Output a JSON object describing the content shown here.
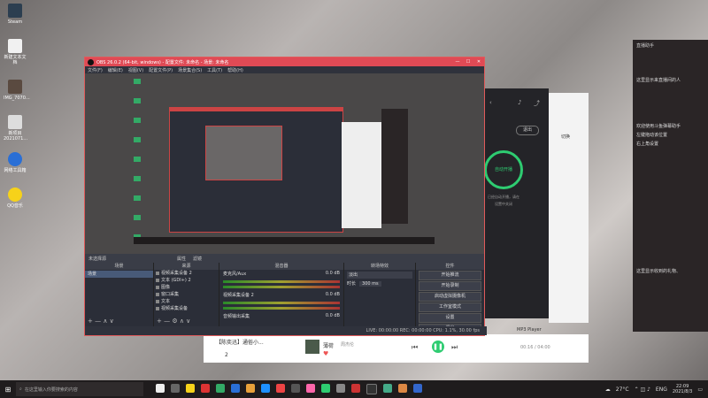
{
  "desktop": {
    "icons": [
      {
        "label": "Steam"
      },
      {
        "label": "新建文本文档"
      },
      {
        "label": "IMG_7070..."
      },
      {
        "label": "新项目\n2021071..."
      },
      {
        "label": "网络工具箱"
      },
      {
        "label": "QQ音乐"
      }
    ]
  },
  "obs": {
    "title": "OBS 26.0.2 (64-bit, windows) - 配置文件: 未命名 - 场景: 未命名",
    "window_controls": [
      "—",
      "☐",
      "✕"
    ],
    "menu": [
      "文件(F)",
      "编辑(E)",
      "视图(V)",
      "配置文件(P)",
      "场景集合(S)",
      "工具(T)",
      "帮助(H)"
    ],
    "selected_source_bar": "未选择源",
    "selected_source_actions": [
      "属性",
      "滤镜"
    ],
    "docks": {
      "scenes_title": "场景",
      "scenes": [
        "场景"
      ],
      "sources_title": "来源",
      "sources": [
        "视频采集设备 2",
        "文本 (GDI+) 2",
        "图像",
        "窗口采集",
        "文本",
        "视频采集设备"
      ],
      "mixer_title": "混音器",
      "mixer_channels": [
        {
          "name": "麦克风/Aux",
          "level": "0.0 dB"
        },
        {
          "name": "视频采集设备 2",
          "level": "0.0 dB"
        },
        {
          "name": "音频输出采集",
          "level": "0.0 dB"
        }
      ],
      "transitions_title": "转场特效",
      "transition_value": "淡出",
      "duration_label": "时长",
      "duration_value": "300 ms",
      "controls_title": "控件",
      "controls": [
        "开始推流",
        "开始录制",
        "启动虚拟摄像机",
        "工作室模式",
        "设置",
        "退出"
      ]
    },
    "statusbar": "LIVE: 00:00:00   REC: 00:00:00   CPU: 1.1%, 30.00 fps"
  },
  "music_app": {
    "button_label": "自动开播",
    "text_lines": [
      "已经自动开播，请在",
      "设置中关闭"
    ],
    "upload_button": "退出",
    "right_label": "切换",
    "bottom_label": "MP3 Player"
  },
  "right_panel": {
    "header": "直播助手",
    "lines": [
      "这里显示来直播间的人",
      "欢迎使用斗鱼弹幕助手",
      "左键拖动该位置",
      "右上角设置"
    ],
    "footer": "这里显示收到的礼物、"
  },
  "player_bar": {
    "track": "薄荷",
    "artist": "周杰伦",
    "left_text": "【陈奕迅】通俗小...",
    "time": "00:16 / 04:00",
    "page": "2"
  },
  "taskbar": {
    "search_placeholder": "在这里输入你要搜索的内容",
    "weather": "27°C",
    "lang": "ENG",
    "time": "22:09",
    "date": "2021/8/3"
  },
  "colors": {
    "obs_title": "#e04a55",
    "music_accent": "#2ecc71"
  }
}
